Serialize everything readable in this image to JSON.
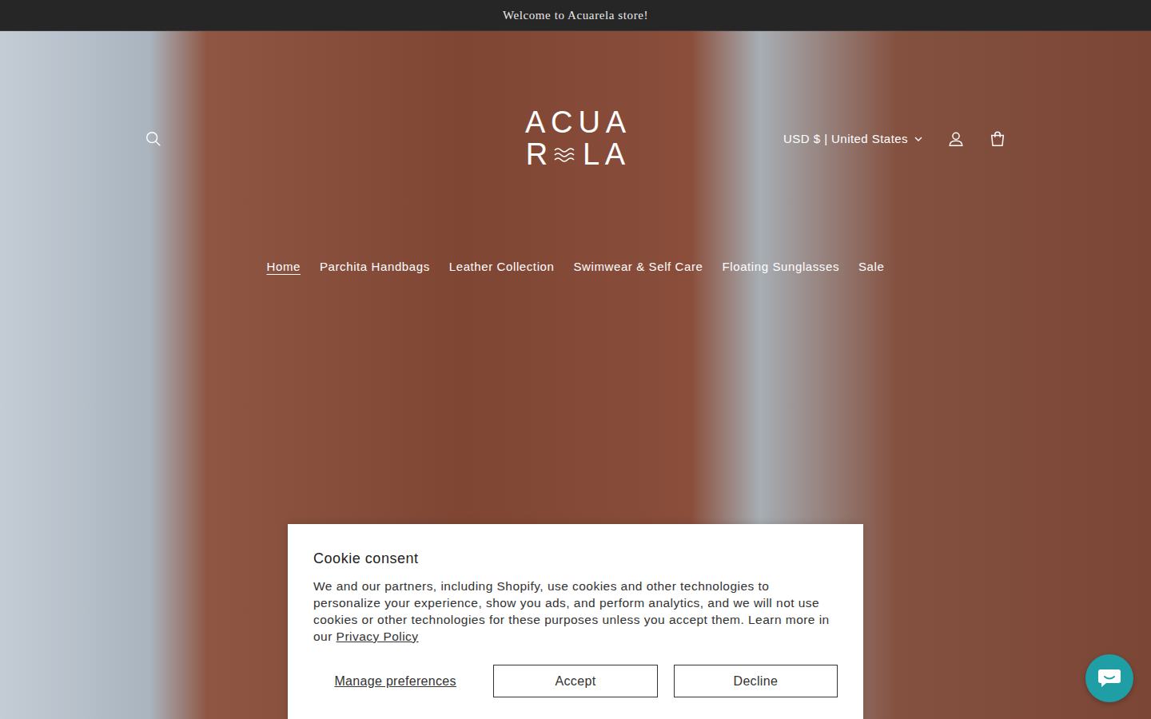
{
  "announcement": "Welcome to Acuarela store!",
  "header": {
    "logo": {
      "top": "ACUA",
      "bottom_start": "R",
      "bottom_end": "LA"
    },
    "currency": "USD $ | United States"
  },
  "nav": [
    {
      "label": "Home",
      "selected": true
    },
    {
      "label": "Parchita Handbags",
      "selected": false
    },
    {
      "label": "Leather Collection",
      "selected": false
    },
    {
      "label": "Swimwear & Self Care",
      "selected": false
    },
    {
      "label": "Floating Sunglasses",
      "selected": false
    },
    {
      "label": "Sale",
      "selected": false
    }
  ],
  "cookie": {
    "title": "Cookie consent",
    "text": "We and our partners, including Shopify, use cookies and other technologies to personalize your experience, show you ads, and perform analytics, and we will not use cookies or other technologies for these purposes unless you accept them. Learn more in our ",
    "link": "Privacy Policy",
    "manage": "Manage preferences",
    "accept": "Accept",
    "decline": "Decline"
  }
}
